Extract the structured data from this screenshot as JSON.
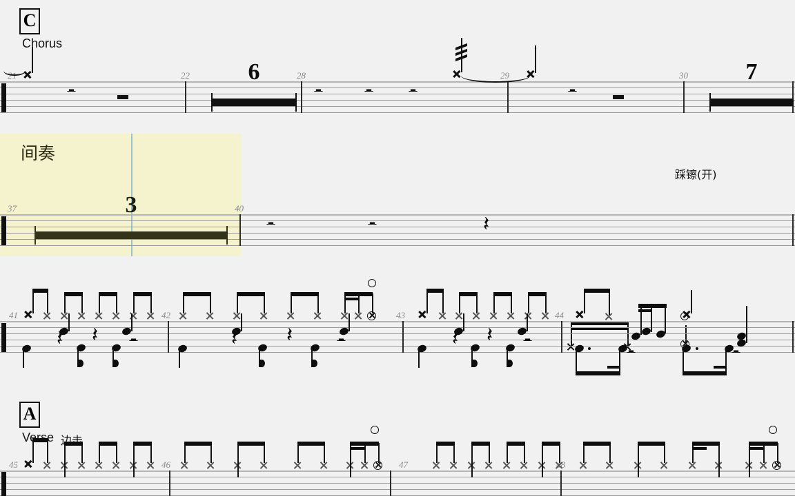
{
  "document": {
    "type": "drum-sheet-music",
    "background_color": "#f1f1f1",
    "selection_color": "#f5f3cd",
    "playhead_color": "#9fc3cd",
    "staff_line_color": "#9a9a9a",
    "ink_color": "#111111",
    "measure_number_color": "#8a8a8a"
  },
  "systems": [
    {
      "id": "system-1",
      "rehearsal_mark": "C",
      "section_label": "Chorus",
      "measures": [
        "21",
        "22",
        "28",
        "29",
        "30"
      ],
      "multi_measure_rests": [
        {
          "count": "6",
          "after_measure": "22"
        },
        {
          "count": "7",
          "after_measure": "30"
        }
      ],
      "annotations": []
    },
    {
      "id": "system-2",
      "rehearsal_mark": "",
      "section_label": "",
      "section_label_cn": "间奏",
      "measures": [
        "37",
        "40"
      ],
      "multi_measure_rests": [
        {
          "count": "3",
          "after_measure": "37"
        }
      ],
      "annotations": [
        "踩镲(开)"
      ],
      "selected": true
    },
    {
      "id": "system-3",
      "rehearsal_mark": "",
      "section_label": "",
      "measures": [
        "41",
        "42",
        "43",
        "44"
      ],
      "multi_measure_rests": [],
      "annotations": []
    },
    {
      "id": "system-4",
      "rehearsal_mark": "A",
      "section_label": "Verse",
      "section_label_cn": "边击",
      "measures": [
        "45",
        "46",
        "47",
        "48"
      ],
      "multi_measure_rests": [],
      "annotations": []
    }
  ],
  "labels": {
    "rehearsal_c": "C",
    "rehearsal_a": "A",
    "chorus": "Chorus",
    "verse": "Verse",
    "interlude_cn": "间奏",
    "sidestick_cn": "边击",
    "hihat_open_cn": "踩镲(开)"
  },
  "measure_numbers": {
    "m21": "21",
    "m22": "22",
    "m28": "28",
    "m29": "29",
    "m30": "30",
    "m37": "37",
    "m40": "40",
    "m41": "41",
    "m42": "42",
    "m43": "43",
    "m44": "44",
    "m45": "45",
    "m46": "46",
    "m47": "47",
    "m48": "48"
  },
  "rest_counts": {
    "r6": "6",
    "r7": "7",
    "r3": "3"
  }
}
